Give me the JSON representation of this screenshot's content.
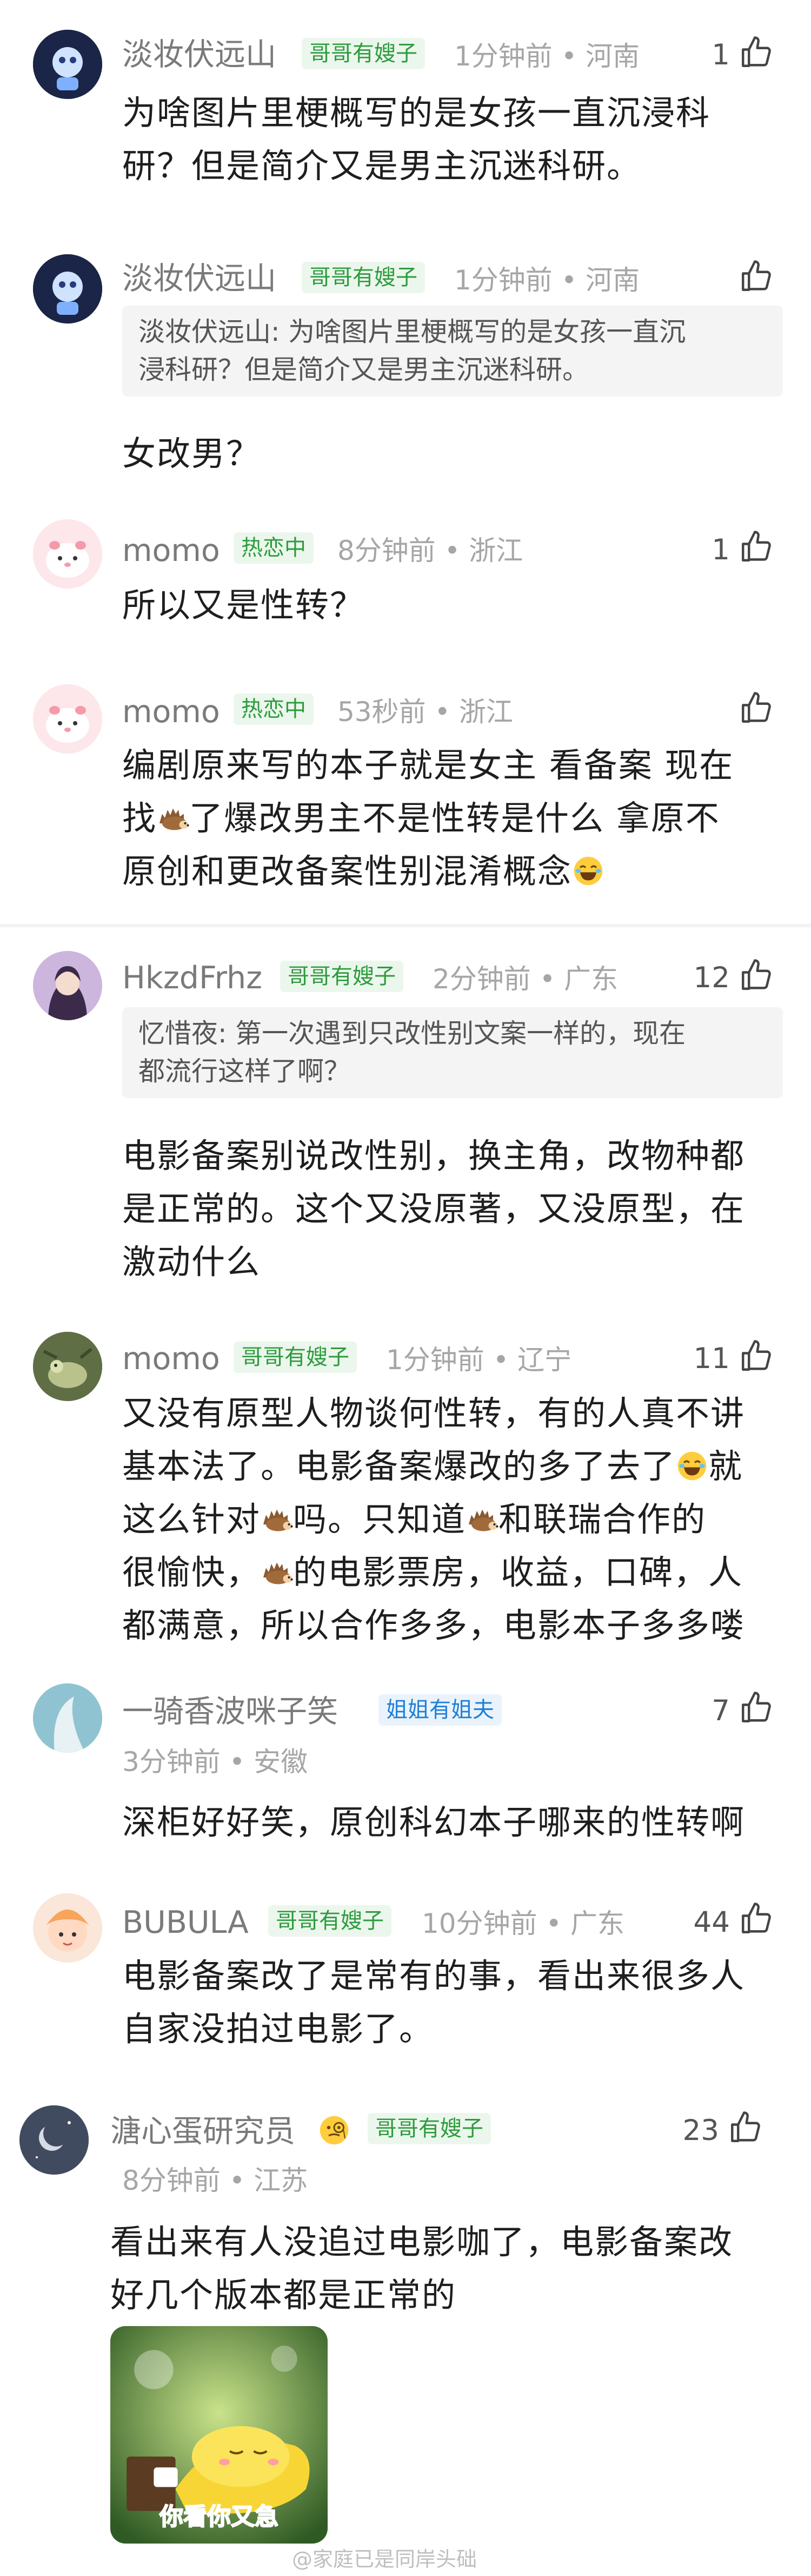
{
  "colors": {
    "badge_green": "#2e9b3e",
    "badge_blue": "#1f7fd6",
    "meta": "#a6a6a6"
  },
  "comments": [
    {
      "username": "淡妆伏远山",
      "badge": "哥哥有嫂子",
      "meta": "1分钟前 • 河南",
      "likes": "1",
      "body_lines": [
        "为啥图片里梗概写的是女孩一直沉浸科",
        "研？但是简介又是男主沉迷科研。"
      ]
    },
    {
      "username": "淡妆伏远山",
      "badge": "哥哥有嫂子",
      "meta": "1分钟前 • 河南",
      "likes": "",
      "quote_lines": [
        "淡妆伏远山: 为啥图片里梗概写的是女孩一直沉",
        "浸科研？但是简介又是男主沉迷科研。"
      ],
      "body_lines": [
        "女改男？"
      ]
    },
    {
      "username": "momo",
      "badge": "热恋中",
      "meta": "8分钟前 • 浙江",
      "likes": "1",
      "body_lines": [
        "所以又是性转？"
      ]
    },
    {
      "username": "momo",
      "badge": "热恋中",
      "meta": "53秒前 • 浙江",
      "likes": "",
      "body_lines": [
        "编剧原来写的本子就是女主 看备案 现在",
        "找",
        "了爆改男主不是性转是什么 拿原不",
        "原创和更改备案性别混淆概念"
      ]
    },
    {
      "username": "HkzdFrhz",
      "badge": "哥哥有嫂子",
      "meta": "2分钟前 • 广东",
      "likes": "12",
      "quote_lines": [
        "忆惜夜: 第一次遇到只改性别文案一样的，现在",
        "都流行这样了啊？"
      ],
      "body_lines": [
        "电影备案别说改性别，换主角，改物种都",
        "是正常的。这个又没原著，又没原型，在",
        "激动什么"
      ]
    },
    {
      "username": "momo",
      "badge": "哥哥有嫂子",
      "meta": "1分钟前 • 辽宁",
      "likes": "11",
      "body_lines": [
        "又没有原型人物谈何性转，有的人真不讲",
        "基本法了。电影备案爆改的多了去了",
        "就",
        "这么针对",
        "吗。只知道",
        "和联瑞合作的",
        "很愉快，",
        "的电影票房，收益，口碑，人",
        "都满意，所以合作多多，电影本子多多喽"
      ]
    },
    {
      "username": "一骑香波咪子笑",
      "badge": "姐姐有姐夫",
      "meta": "3分钟前 • 安徽",
      "likes": "7",
      "body_lines": [
        "深柜好好笑，原创科幻本子哪来的性转啊"
      ]
    },
    {
      "username": "BUBULA",
      "badge": "哥哥有嫂子",
      "meta": "10分钟前 • 广东",
      "likes": "44",
      "body_lines": [
        "电影备案改了是常有的事，看出来很多人",
        "自家没拍过电影了。"
      ]
    },
    {
      "username": "溏心蛋研究员",
      "badge": "哥哥有嫂子",
      "meta": "8分钟前 • 江苏",
      "likes": "23",
      "body_lines": [
        "看出来有人没追过电影咖了，电影备案改",
        "好几个版本都是正常的"
      ],
      "sticker_text": "你看你又急"
    }
  ],
  "watermark": "@家庭已是同岸头础",
  "icons": [
    "thumbs-up-icon",
    "laugh-cry-emoji-icon",
    "hedgehog-emoji-icon",
    "monocle-emoji-icon"
  ]
}
